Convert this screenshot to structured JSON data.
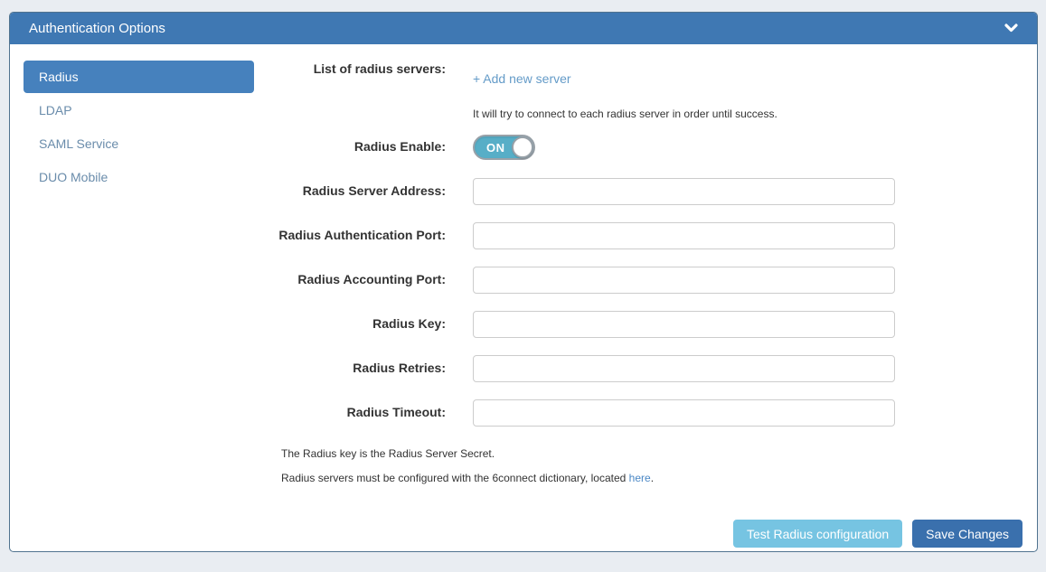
{
  "panel": {
    "title": "Authentication Options"
  },
  "sidebar": {
    "active": "Radius",
    "items": [
      {
        "label": "Radius"
      },
      {
        "label": "LDAP"
      },
      {
        "label": "SAML Service"
      },
      {
        "label": "DUO Mobile"
      }
    ]
  },
  "form": {
    "server_list": {
      "label": "List of radius servers:",
      "add_link": "+ Add new server",
      "helper": "It will try to connect to each radius server in order until success."
    },
    "enable": {
      "label": "Radius Enable:",
      "state": "ON"
    },
    "fields": [
      {
        "label": "Radius Server Address:",
        "value": ""
      },
      {
        "label": "Radius Authentication Port:",
        "value": ""
      },
      {
        "label": "Radius Accounting Port:",
        "value": ""
      },
      {
        "label": "Radius Key:",
        "value": ""
      },
      {
        "label": "Radius Retries:",
        "value": ""
      },
      {
        "label": "Radius Timeout:",
        "value": ""
      }
    ],
    "notes": {
      "line1": "The Radius key is the Radius Server Secret.",
      "line2_text": "Radius servers must be configured with the 6connect dictionary, located",
      "line2_link": "here",
      "line2_suffix": "."
    }
  },
  "actions": {
    "test_label": "Test Radius configuration",
    "save_label": "Save Changes"
  },
  "icons": {
    "header_collapse": "chevron-down"
  },
  "colors": {
    "page_background": "#e9edf2",
    "header": "#3f78b3",
    "active_tab": "#4681bd",
    "inactive_tab_text": "#6a8cab",
    "toggle_on": "#57aec7",
    "test_button": "#76c4e2",
    "save_button": "#3a70ad",
    "add_link": "#649bc8",
    "here_link": "#4a87c5"
  }
}
